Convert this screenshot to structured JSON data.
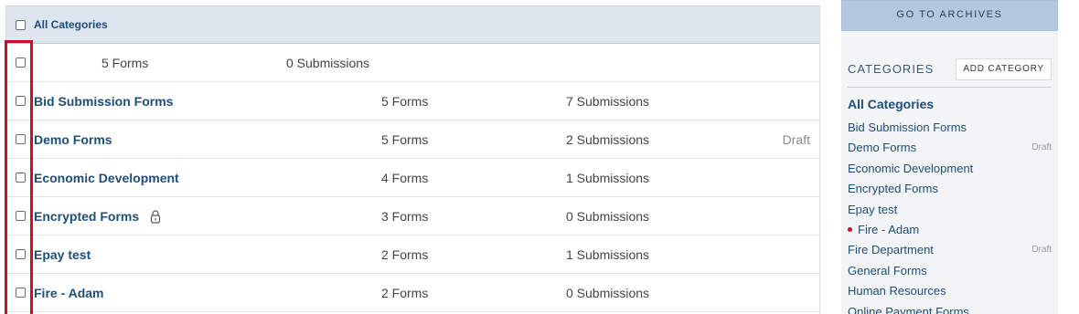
{
  "header": {
    "label": "All Categories"
  },
  "summary": {
    "forms": "5  Forms",
    "submissions": "0  Submissions"
  },
  "rows": [
    {
      "name": "Bid Submission Forms",
      "forms": "5  Forms",
      "submissions": "7  Submissions",
      "status": ""
    },
    {
      "name": "Demo Forms",
      "forms": "5  Forms",
      "submissions": "2  Submissions",
      "status": "Draft"
    },
    {
      "name": "Economic Development",
      "forms": "4  Forms",
      "submissions": "1  Submissions",
      "status": ""
    },
    {
      "name": "Encrypted Forms",
      "forms": "3  Forms",
      "submissions": "0  Submissions",
      "status": "",
      "icon": "lock-icon"
    },
    {
      "name": "Epay test",
      "forms": "2  Forms",
      "submissions": "1  Submissions",
      "status": ""
    },
    {
      "name": "Fire - Adam",
      "forms": "2  Forms",
      "submissions": "0  Submissions",
      "status": ""
    }
  ],
  "sidebar": {
    "archives_button": "GO TO ARCHIVES",
    "categories_title": "CATEGORIES",
    "add_category_button": "ADD CATEGORY",
    "categories": [
      {
        "label": "All Categories",
        "draft": ""
      },
      {
        "label": "Bid Submission Forms",
        "draft": ""
      },
      {
        "label": "Demo Forms",
        "draft": "Draft"
      },
      {
        "label": "Economic Development",
        "draft": ""
      },
      {
        "label": "Encrypted Forms",
        "draft": ""
      },
      {
        "label": "Epay test",
        "draft": ""
      },
      {
        "label": "Fire - Adam",
        "draft": ""
      },
      {
        "label": "Fire Department",
        "draft": "Draft"
      },
      {
        "label": "General Forms",
        "draft": ""
      },
      {
        "label": "Human Resources",
        "draft": ""
      },
      {
        "label": "Online Payment Forms",
        "draft": ""
      }
    ]
  },
  "colors": {
    "accent": "#1f4e79",
    "highlight": "#c8102e",
    "header_bg": "#dde5ef",
    "sidebar_bg": "#f2f4f6",
    "button_bg": "#b4c9df"
  }
}
